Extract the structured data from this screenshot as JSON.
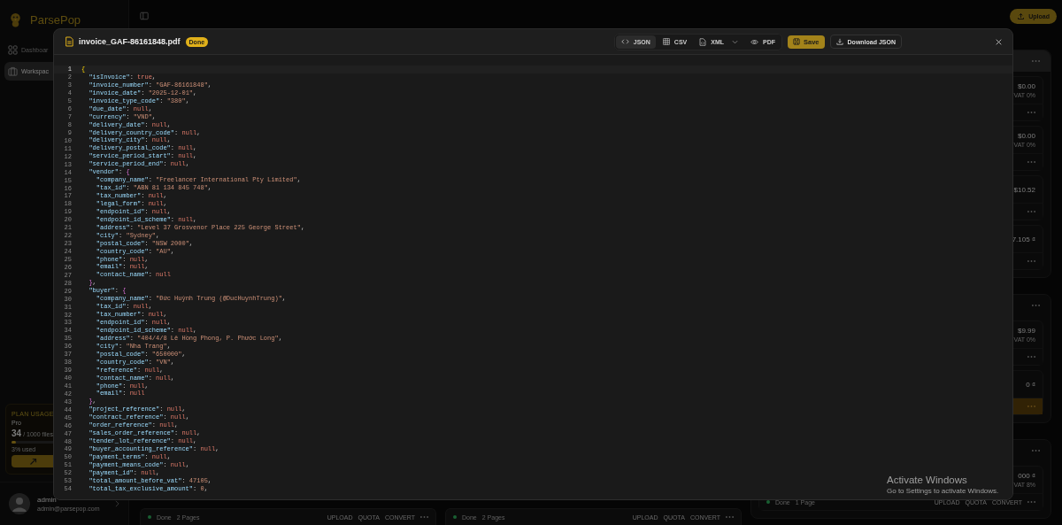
{
  "sidebar": {
    "brand": "ParsePop",
    "nav": [
      {
        "label": "Dashboar",
        "selected": false
      },
      {
        "label": "Workspac",
        "selected": true
      }
    ],
    "plan": {
      "title": "PLAN USAGE",
      "tier": "Pro",
      "used": "34",
      "limit": "/ 1000 files",
      "level": 0.034,
      "percent": "3% used"
    },
    "user": {
      "name": "admin",
      "email": "admin@parsepop.com"
    }
  },
  "topbar": {
    "upload": "Upload"
  },
  "groups": [
    {
      "cards": [
        {
          "amount": "$0.00",
          "vat": "VAT 0%",
          "warning": false
        },
        {
          "amount": "$0.00",
          "vat": "VAT 0%",
          "warning": false
        },
        {
          "amount": "$10.52",
          "warning": false
        },
        {
          "amount": "7.105 ₫",
          "warning": false
        }
      ]
    },
    {
      "cards": [
        {
          "amount": "$9.99",
          "vat": "VAT 0%",
          "warning": false
        },
        {
          "amount": "0 ₫",
          "warning": true
        }
      ]
    },
    {
      "cards": [
        {
          "amount": "000 ₫",
          "vat": "VAT 8%",
          "warning": false
        }
      ]
    }
  ],
  "bottom_cards": [
    {
      "status": "Done",
      "pages": "2 Pages",
      "actions": [
        "UPLOAD",
        "QUOTA",
        "CONVERT"
      ]
    },
    {
      "status": "Done",
      "pages": "2 Pages",
      "actions": [
        "UPLOAD",
        "QUOTA",
        "CONVERT"
      ]
    },
    {
      "status": "Done",
      "pages": "1 Page",
      "actions": [
        "UPLOAD",
        "QUOTA",
        "CONVERT"
      ]
    }
  ],
  "modal": {
    "filename": "invoice_GAF-86161848.pdf",
    "status": "Done",
    "views": [
      {
        "label": "JSON",
        "kind": "code",
        "selected": true
      },
      {
        "label": "CSV",
        "kind": "table",
        "selected": false
      },
      {
        "label": "XML",
        "kind": "xml",
        "selected": false
      },
      {
        "label": "PDF",
        "kind": "eye",
        "selected": false
      }
    ],
    "save": "Save",
    "download": "Download JSON",
    "lines": [
      {
        "num": "1",
        "text": "{",
        "active": true
      },
      {
        "num": "2",
        "text": "  \"isInvoice\": true,",
        "active": false
      },
      {
        "num": "3",
        "text": "  \"invoice_number\": \"GAF-86161848\",",
        "active": false
      },
      {
        "num": "4",
        "text": "  \"invoice_date\": \"2025-12-01\",",
        "active": false
      },
      {
        "num": "5",
        "text": "  \"invoice_type_code\": \"380\",",
        "active": false
      },
      {
        "num": "6",
        "text": "  \"due_date\": null,",
        "active": false
      },
      {
        "num": "7",
        "text": "  \"currency\": \"VND\",",
        "active": false
      },
      {
        "num": "8",
        "text": "  \"delivery_date\": null,",
        "active": false
      },
      {
        "num": "9",
        "text": "  \"delivery_country_code\": null,",
        "active": false
      },
      {
        "num": "10",
        "text": "  \"delivery_city\": null,",
        "active": false
      },
      {
        "num": "11",
        "text": "  \"delivery_postal_code\": null,",
        "active": false
      },
      {
        "num": "12",
        "text": "  \"service_period_start\": null,",
        "active": false
      },
      {
        "num": "13",
        "text": "  \"service_period_end\": null,",
        "active": false
      },
      {
        "num": "14",
        "text": "  \"vendor\": {",
        "active": false
      },
      {
        "num": "15",
        "text": "    \"company_name\": \"Freelancer International Pty Limited\",",
        "active": false
      },
      {
        "num": "16",
        "text": "    \"tax_id\": \"ABN 81 134 845 748\",",
        "active": false
      },
      {
        "num": "17",
        "text": "    \"tax_number\": null,",
        "active": false
      },
      {
        "num": "18",
        "text": "    \"legal_form\": null,",
        "active": false
      },
      {
        "num": "19",
        "text": "    \"endpoint_id\": null,",
        "active": false
      },
      {
        "num": "20",
        "text": "    \"endpoint_id_scheme\": null,",
        "active": false
      },
      {
        "num": "21",
        "text": "    \"address\": \"Level 37 Grosvenor Place 225 George Street\",",
        "active": false
      },
      {
        "num": "22",
        "text": "    \"city\": \"Sydney\",",
        "active": false
      },
      {
        "num": "23",
        "text": "    \"postal_code\": \"NSW 2000\",",
        "active": false
      },
      {
        "num": "24",
        "text": "    \"country_code\": \"AU\",",
        "active": false
      },
      {
        "num": "25",
        "text": "    \"phone\": null,",
        "active": false
      },
      {
        "num": "26",
        "text": "    \"email\": null,",
        "active": false
      },
      {
        "num": "27",
        "text": "    \"contact_name\": null",
        "active": false
      },
      {
        "num": "28",
        "text": "  },",
        "active": false
      },
      {
        "num": "29",
        "text": "  \"buyer\": {",
        "active": false
      },
      {
        "num": "30",
        "text": "    \"company_name\": \"Đức Huỳnh Trung (@DucHuynhTrung)\",",
        "active": false
      },
      {
        "num": "31",
        "text": "    \"tax_id\": null,",
        "active": false
      },
      {
        "num": "32",
        "text": "    \"tax_number\": null,",
        "active": false
      },
      {
        "num": "33",
        "text": "    \"endpoint_id\": null,",
        "active": false
      },
      {
        "num": "34",
        "text": "    \"endpoint_id_scheme\": null,",
        "active": false
      },
      {
        "num": "35",
        "text": "    \"address\": \"404/4/8 Lê Hồng Phong, P. Phước Long\",",
        "active": false
      },
      {
        "num": "36",
        "text": "    \"city\": \"Nha Trang\",",
        "active": false
      },
      {
        "num": "37",
        "text": "    \"postal_code\": \"650000\",",
        "active": false
      },
      {
        "num": "38",
        "text": "    \"country_code\": \"VN\",",
        "active": false
      },
      {
        "num": "39",
        "text": "    \"reference\": null,",
        "active": false
      },
      {
        "num": "40",
        "text": "    \"contact_name\": null,",
        "active": false
      },
      {
        "num": "41",
        "text": "    \"phone\": null,",
        "active": false
      },
      {
        "num": "42",
        "text": "    \"email\": null",
        "active": false
      },
      {
        "num": "43",
        "text": "  },",
        "active": false
      },
      {
        "num": "44",
        "text": "  \"project_reference\": null,",
        "active": false
      },
      {
        "num": "45",
        "text": "  \"contract_reference\": null,",
        "active": false
      },
      {
        "num": "46",
        "text": "  \"order_reference\": null,",
        "active": false
      },
      {
        "num": "47",
        "text": "  \"sales_order_reference\": null,",
        "active": false
      },
      {
        "num": "48",
        "text": "  \"tender_lot_reference\": null,",
        "active": false
      },
      {
        "num": "49",
        "text": "  \"buyer_accounting_reference\": null,",
        "active": false
      },
      {
        "num": "50",
        "text": "  \"payment_terms\": null,",
        "active": false
      },
      {
        "num": "51",
        "text": "  \"payment_means_code\": null,",
        "active": false
      },
      {
        "num": "52",
        "text": "  \"payment_id\": null,",
        "active": false
      },
      {
        "num": "53",
        "text": "  \"total_amount_before_vat\": 47105,",
        "active": false
      },
      {
        "num": "54",
        "text": "  \"total_tax_exclusive_amount\": 0,",
        "active": false
      }
    ]
  },
  "windows_notice": {
    "title": "Activate Windows",
    "text": "Go to Settings to activate Windows."
  }
}
